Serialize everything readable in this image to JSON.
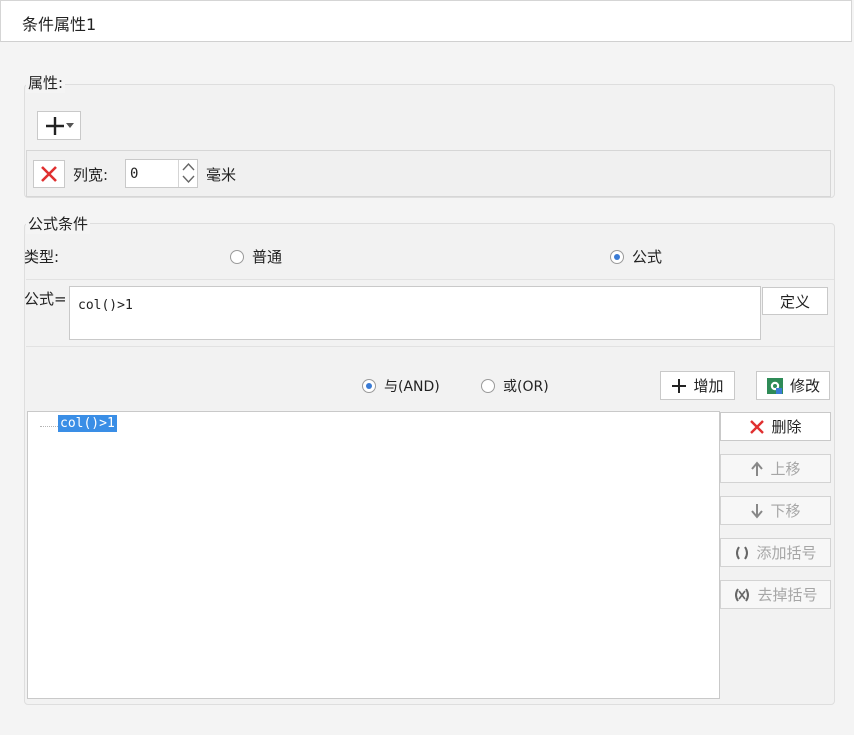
{
  "window": {
    "title": "条件属性1"
  },
  "attributes": {
    "legend": "属性:",
    "add_icon": "plus-icon",
    "col_width_label": "列宽:",
    "col_width_value": "0",
    "unit": "毫米"
  },
  "formula_condition": {
    "legend": "公式条件",
    "type_label": "类型:",
    "type_options": [
      "普通",
      "公式"
    ],
    "type_selected": "公式",
    "formula_label": "公式=",
    "formula_value": "col()>1",
    "define_button": "定义"
  },
  "logic": {
    "and_label": "与(AND)",
    "or_label": "或(OR)",
    "selected": "and",
    "add_button": "增加",
    "modify_button": "修改"
  },
  "tree": {
    "items": [
      "col()>1"
    ]
  },
  "side_buttons": {
    "delete": "删除",
    "move_up": "上移",
    "move_down": "下移",
    "add_bracket": "添加括号",
    "remove_bracket": "去掉括号"
  },
  "colors": {
    "accent": "#3a7bd5",
    "delete_red": "#e03030",
    "selection": "#3a8ee6"
  }
}
